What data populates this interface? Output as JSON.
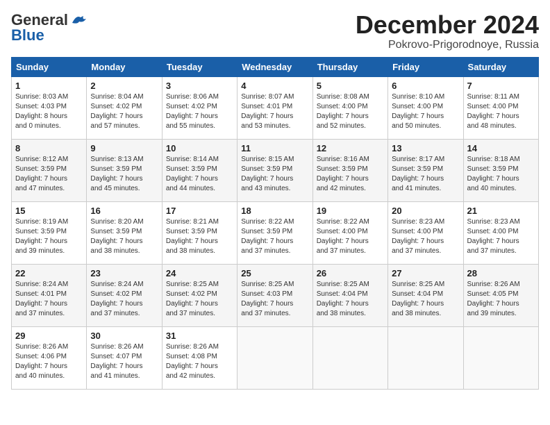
{
  "header": {
    "logo_line1": "General",
    "logo_line2": "Blue",
    "month": "December 2024",
    "location": "Pokrovo-Prigorodnoye, Russia"
  },
  "days_of_week": [
    "Sunday",
    "Monday",
    "Tuesday",
    "Wednesday",
    "Thursday",
    "Friday",
    "Saturday"
  ],
  "weeks": [
    [
      {
        "day": 1,
        "sunrise": "8:03 AM",
        "sunset": "4:03 PM",
        "daylight": "8 hours and 0 minutes."
      },
      {
        "day": 2,
        "sunrise": "8:04 AM",
        "sunset": "4:02 PM",
        "daylight": "7 hours and 57 minutes."
      },
      {
        "day": 3,
        "sunrise": "8:06 AM",
        "sunset": "4:02 PM",
        "daylight": "7 hours and 55 minutes."
      },
      {
        "day": 4,
        "sunrise": "8:07 AM",
        "sunset": "4:01 PM",
        "daylight": "7 hours and 53 minutes."
      },
      {
        "day": 5,
        "sunrise": "8:08 AM",
        "sunset": "4:00 PM",
        "daylight": "7 hours and 52 minutes."
      },
      {
        "day": 6,
        "sunrise": "8:10 AM",
        "sunset": "4:00 PM",
        "daylight": "7 hours and 50 minutes."
      },
      {
        "day": 7,
        "sunrise": "8:11 AM",
        "sunset": "4:00 PM",
        "daylight": "7 hours and 48 minutes."
      }
    ],
    [
      {
        "day": 8,
        "sunrise": "8:12 AM",
        "sunset": "3:59 PM",
        "daylight": "7 hours and 47 minutes."
      },
      {
        "day": 9,
        "sunrise": "8:13 AM",
        "sunset": "3:59 PM",
        "daylight": "7 hours and 45 minutes."
      },
      {
        "day": 10,
        "sunrise": "8:14 AM",
        "sunset": "3:59 PM",
        "daylight": "7 hours and 44 minutes."
      },
      {
        "day": 11,
        "sunrise": "8:15 AM",
        "sunset": "3:59 PM",
        "daylight": "7 hours and 43 minutes."
      },
      {
        "day": 12,
        "sunrise": "8:16 AM",
        "sunset": "3:59 PM",
        "daylight": "7 hours and 42 minutes."
      },
      {
        "day": 13,
        "sunrise": "8:17 AM",
        "sunset": "3:59 PM",
        "daylight": "7 hours and 41 minutes."
      },
      {
        "day": 14,
        "sunrise": "8:18 AM",
        "sunset": "3:59 PM",
        "daylight": "7 hours and 40 minutes."
      }
    ],
    [
      {
        "day": 15,
        "sunrise": "8:19 AM",
        "sunset": "3:59 PM",
        "daylight": "7 hours and 39 minutes."
      },
      {
        "day": 16,
        "sunrise": "8:20 AM",
        "sunset": "3:59 PM",
        "daylight": "7 hours and 38 minutes."
      },
      {
        "day": 17,
        "sunrise": "8:21 AM",
        "sunset": "3:59 PM",
        "daylight": "7 hours and 38 minutes."
      },
      {
        "day": 18,
        "sunrise": "8:22 AM",
        "sunset": "3:59 PM",
        "daylight": "7 hours and 37 minutes."
      },
      {
        "day": 19,
        "sunrise": "8:22 AM",
        "sunset": "4:00 PM",
        "daylight": "7 hours and 37 minutes."
      },
      {
        "day": 20,
        "sunrise": "8:23 AM",
        "sunset": "4:00 PM",
        "daylight": "7 hours and 37 minutes."
      },
      {
        "day": 21,
        "sunrise": "8:23 AM",
        "sunset": "4:00 PM",
        "daylight": "7 hours and 37 minutes."
      }
    ],
    [
      {
        "day": 22,
        "sunrise": "8:24 AM",
        "sunset": "4:01 PM",
        "daylight": "7 hours and 37 minutes."
      },
      {
        "day": 23,
        "sunrise": "8:24 AM",
        "sunset": "4:02 PM",
        "daylight": "7 hours and 37 minutes."
      },
      {
        "day": 24,
        "sunrise": "8:25 AM",
        "sunset": "4:02 PM",
        "daylight": "7 hours and 37 minutes."
      },
      {
        "day": 25,
        "sunrise": "8:25 AM",
        "sunset": "4:03 PM",
        "daylight": "7 hours and 37 minutes."
      },
      {
        "day": 26,
        "sunrise": "8:25 AM",
        "sunset": "4:04 PM",
        "daylight": "7 hours and 38 minutes."
      },
      {
        "day": 27,
        "sunrise": "8:25 AM",
        "sunset": "4:04 PM",
        "daylight": "7 hours and 38 minutes."
      },
      {
        "day": 28,
        "sunrise": "8:26 AM",
        "sunset": "4:05 PM",
        "daylight": "7 hours and 39 minutes."
      }
    ],
    [
      {
        "day": 29,
        "sunrise": "8:26 AM",
        "sunset": "4:06 PM",
        "daylight": "7 hours and 40 minutes."
      },
      {
        "day": 30,
        "sunrise": "8:26 AM",
        "sunset": "4:07 PM",
        "daylight": "7 hours and 41 minutes."
      },
      {
        "day": 31,
        "sunrise": "8:26 AM",
        "sunset": "4:08 PM",
        "daylight": "7 hours and 42 minutes."
      },
      null,
      null,
      null,
      null
    ]
  ],
  "labels": {
    "sunrise": "Sunrise:",
    "sunset": "Sunset:",
    "daylight": "Daylight hours"
  }
}
